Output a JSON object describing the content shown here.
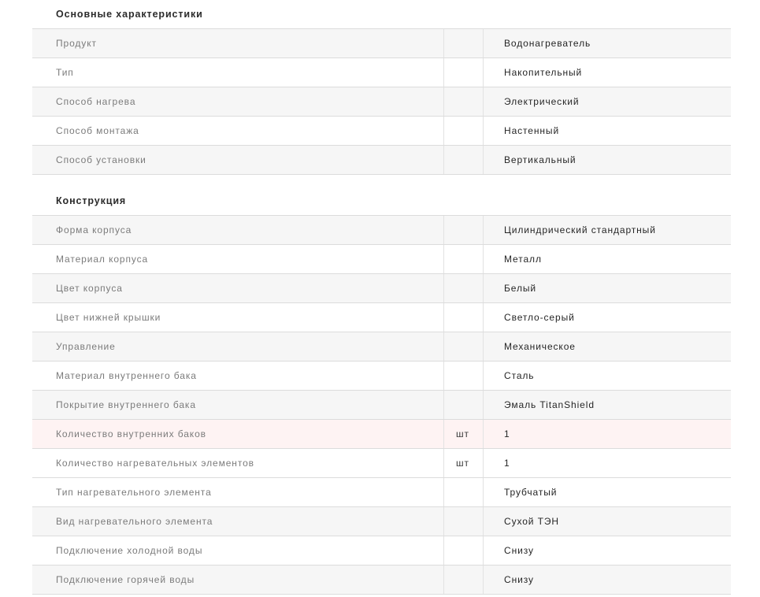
{
  "sections": [
    {
      "title": "Основные характеристики",
      "rows": [
        {
          "name": "Продукт",
          "unit": "",
          "value": "Водонагреватель"
        },
        {
          "name": "Тип",
          "unit": "",
          "value": "Накопительный"
        },
        {
          "name": "Способ нагрева",
          "unit": "",
          "value": "Электрический"
        },
        {
          "name": "Способ монтажа",
          "unit": "",
          "value": "Настенный"
        },
        {
          "name": "Способ установки",
          "unit": "",
          "value": "Вертикальный"
        }
      ]
    },
    {
      "title": "Конструкция",
      "rows": [
        {
          "name": "Форма корпуса",
          "unit": "",
          "value": "Цилиндрический стандартный"
        },
        {
          "name": "Материал корпуса",
          "unit": "",
          "value": "Металл"
        },
        {
          "name": "Цвет корпуса",
          "unit": "",
          "value": "Белый"
        },
        {
          "name": "Цвет нижней крышки",
          "unit": "",
          "value": "Светло-серый"
        },
        {
          "name": "Управление",
          "unit": "",
          "value": "Механическое"
        },
        {
          "name": "Материал внутреннего бака",
          "unit": "",
          "value": "Сталь"
        },
        {
          "name": "Покрытие внутреннего бака",
          "unit": "",
          "value": "Эмаль TitanShield"
        },
        {
          "name": "Количество внутренних баков",
          "unit": "шт",
          "value": "1",
          "highlighted": true
        },
        {
          "name": "Количество нагревательных элементов",
          "unit": "шт",
          "value": "1"
        },
        {
          "name": "Тип нагревательного элемента",
          "unit": "",
          "value": "Трубчатый"
        },
        {
          "name": "Вид нагревательного элемента",
          "unit": "",
          "value": "Сухой ТЭН"
        },
        {
          "name": "Подключение холодной воды",
          "unit": "",
          "value": "Снизу"
        },
        {
          "name": "Подключение горячей воды",
          "unit": "",
          "value": "Снизу"
        }
      ]
    }
  ]
}
